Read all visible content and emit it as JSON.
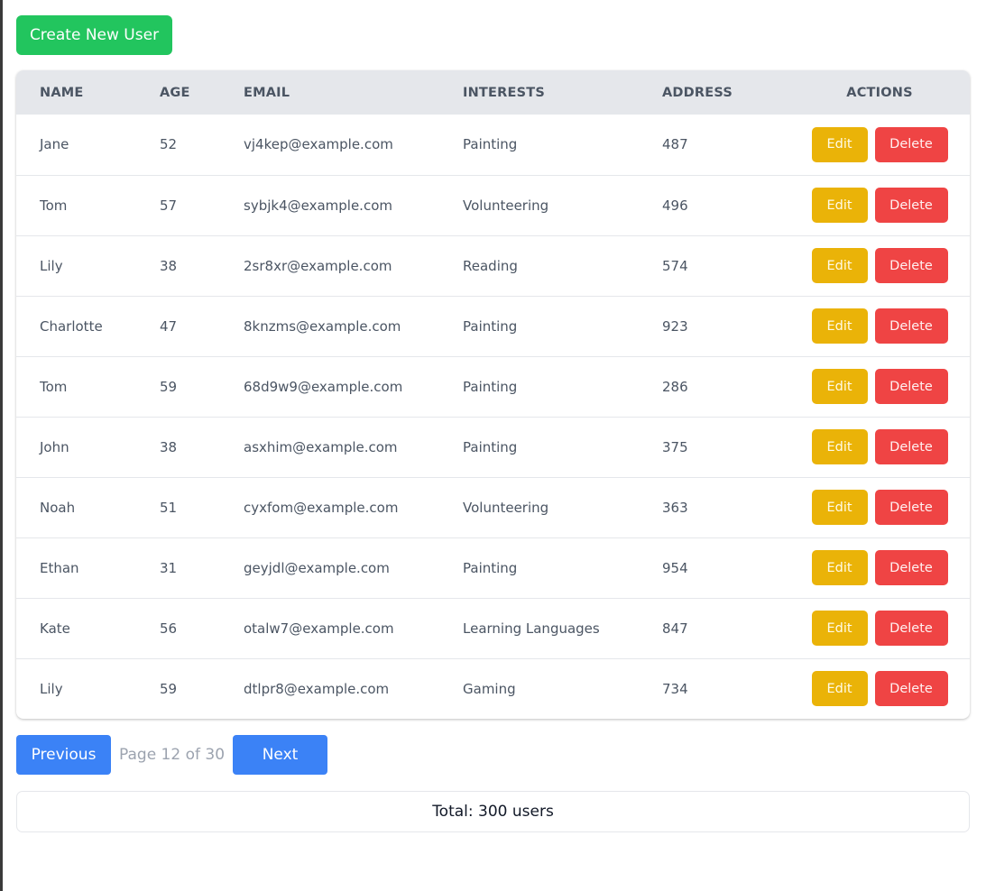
{
  "toolbar": {
    "create_label": "Create New User"
  },
  "table": {
    "headers": {
      "name": "NAME",
      "age": "AGE",
      "email": "EMAIL",
      "interests": "INTERESTS",
      "address": "ADDRESS",
      "actions": "ACTIONS"
    },
    "edit_label": "Edit",
    "delete_label": "Delete",
    "rows": [
      {
        "name": "Jane",
        "age": "52",
        "email": "vj4kep@example.com",
        "interests": "Painting",
        "address": "487"
      },
      {
        "name": "Tom",
        "age": "57",
        "email": "sybjk4@example.com",
        "interests": "Volunteering",
        "address": "496"
      },
      {
        "name": "Lily",
        "age": "38",
        "email": "2sr8xr@example.com",
        "interests": "Reading",
        "address": "574"
      },
      {
        "name": "Charlotte",
        "age": "47",
        "email": "8knzms@example.com",
        "interests": "Painting",
        "address": "923"
      },
      {
        "name": "Tom",
        "age": "59",
        "email": "68d9w9@example.com",
        "interests": "Painting",
        "address": "286"
      },
      {
        "name": "John",
        "age": "38",
        "email": "asxhim@example.com",
        "interests": "Painting",
        "address": "375"
      },
      {
        "name": "Noah",
        "age": "51",
        "email": "cyxfom@example.com",
        "interests": "Volunteering",
        "address": "363"
      },
      {
        "name": "Ethan",
        "age": "31",
        "email": "geyjdl@example.com",
        "interests": "Painting",
        "address": "954"
      },
      {
        "name": "Kate",
        "age": "56",
        "email": "otalw7@example.com",
        "interests": "Learning Languages",
        "address": "847"
      },
      {
        "name": "Lily",
        "age": "59",
        "email": "dtlpr8@example.com",
        "interests": "Gaming",
        "address": "734"
      }
    ]
  },
  "pagination": {
    "previous_label": "Previous",
    "page_info": "Page 12 of 30",
    "next_label": "Next"
  },
  "footer": {
    "total_text": "Total: 300 users"
  },
  "colors": {
    "create": "#22c55e",
    "edit": "#eab308",
    "delete": "#ef4444",
    "pager": "#3b82f6",
    "header_bg": "#e5e7eb"
  }
}
